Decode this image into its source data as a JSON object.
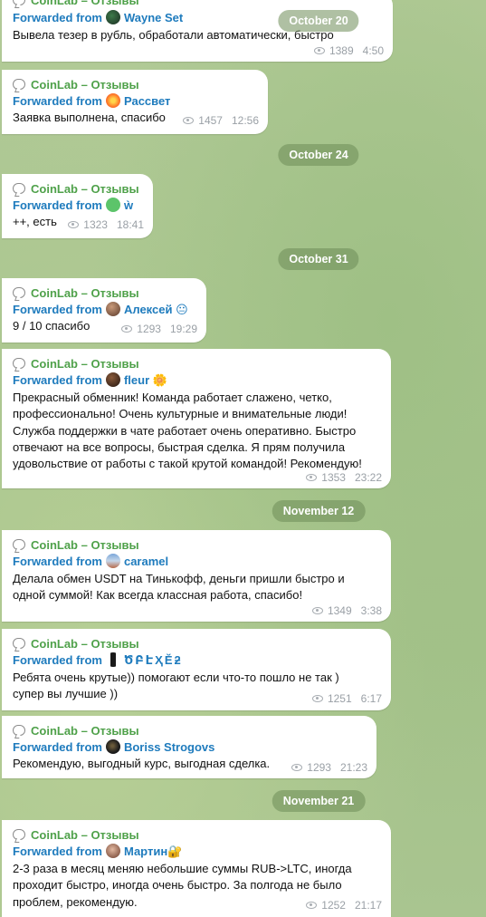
{
  "channel": "CoinLab – Отзывы",
  "forwarded_label": "Forwarded from",
  "colors": {
    "channel_name": "#4fa14a",
    "forward_author": "#1e7bbd",
    "date_pill": "#6d8c58"
  },
  "dates": [
    "October 20",
    "October 24",
    "October 31",
    "November 12",
    "November 21"
  ],
  "messages": [
    {
      "author": "Wayne Set",
      "text": "Вывела тезер в рубль, обработали автоматически, быстро",
      "views": "1389",
      "time": "4:50"
    },
    {
      "author": "Рассвет",
      "text": "Заявка выполнена, спасибо",
      "views": "1457",
      "time": "12:56"
    },
    {
      "author": "ẁ",
      "text": "++, есть",
      "views": "1323",
      "time": "18:41"
    },
    {
      "author": "Алексей 😐",
      "text": "9 / 10 спасибо",
      "views": "1293",
      "time": "19:29"
    },
    {
      "author": "fleur 🌼",
      "text": "Прекрасный обменник! Команда работает слажено, четко, профессионально! Очень культурные и внимательные люди! Служба поддержки в чате работает очень оперативно. Быстро отвечают на все вопросы, быстрая сделка. Я прям получила удовольствие от работы с такой крутой командой! Рекомендую!",
      "views": "1353",
      "time": "23:22"
    },
    {
      "author": "caramel",
      "text": "Делала обмен USDT на Тинькофф, деньги пришли быстро и одной суммой! Как всегда классная работа, спасибо!",
      "views": "1349",
      "time": "3:38"
    },
    {
      "author": "ԾԲԷҲӖƻ",
      "text": "Ребята очень крутые)) помогают если что-то пошло не так ) супер вы лучшие ))",
      "views": "1251",
      "time": "6:17"
    },
    {
      "author": "Boriss Strogovs",
      "text": "Рекомендую, выгодный курс, выгодная сделка.",
      "views": "1293",
      "time": "21:23"
    },
    {
      "author": "Мартин🔐",
      "text": "2-3 раза в месяц меняю небольшие суммы RUB->LTC, иногда проходит быстро, иногда очень быстро. За полгода не было проблем, рекомендую.",
      "views": "1252",
      "time": "21:17"
    }
  ]
}
